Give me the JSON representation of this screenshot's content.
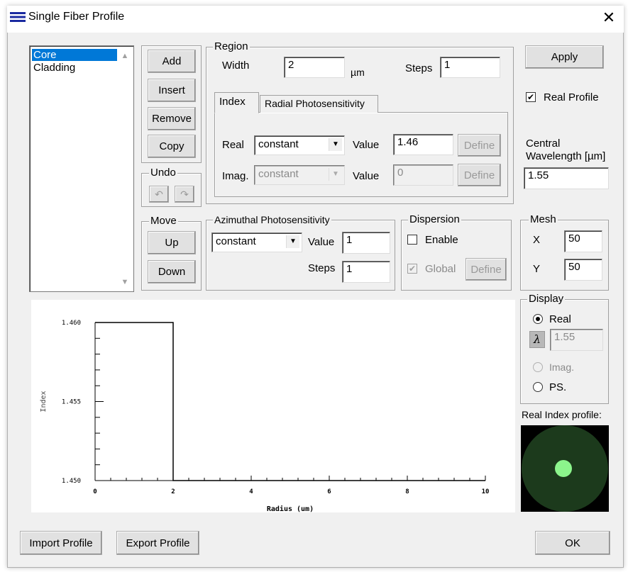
{
  "window": {
    "title": "Single Fiber Profile",
    "close_symbol": "✕"
  },
  "layer_list": {
    "items": [
      "Core",
      "Cladding"
    ],
    "selected_index": 0
  },
  "layer_buttons": {
    "add": "Add",
    "insert": "Insert",
    "remove": "Remove",
    "copy": "Copy"
  },
  "undo": {
    "title": "Undo"
  },
  "move": {
    "title": "Move",
    "up": "Up",
    "down": "Down"
  },
  "region": {
    "title": "Region",
    "width_label": "Width",
    "width_value": "2",
    "width_unit": "µm",
    "steps_label": "Steps",
    "steps_value": "1",
    "tabs": [
      "Index",
      "Radial Photosensitivity"
    ],
    "real_label": "Real",
    "real_select": "constant",
    "real_value_label": "Value",
    "real_value": "1.46",
    "real_define": "Define",
    "imag_label": "Imag.",
    "imag_select": "constant",
    "imag_value_label": "Value",
    "imag_value": "0",
    "imag_define": "Define"
  },
  "right_panel": {
    "apply": "Apply",
    "real_profile_label": "Real Profile",
    "real_profile_checked": true,
    "central_wavelength_label_1": "Central",
    "central_wavelength_label_2": "Wavelength [µm]",
    "central_wavelength_value": "1.55"
  },
  "azimuthal": {
    "title": "Azimuthal Photosensitivity",
    "select": "constant",
    "value_label": "Value",
    "value": "1",
    "steps_label": "Steps",
    "steps_value": "1"
  },
  "dispersion": {
    "title": "Dispersion",
    "enable_label": "Enable",
    "enable_checked": false,
    "global_label": "Global",
    "global_checked": true,
    "define": "Define"
  },
  "mesh": {
    "title": "Mesh",
    "x_label": "X",
    "x_value": "50",
    "y_label": "Y",
    "y_value": "50"
  },
  "display": {
    "title": "Display",
    "real_label": "Real",
    "lambda_symbol": "λ",
    "lambda_value": "1.55",
    "imag_label": "Imag.",
    "ps_label": "PS.",
    "selected": "Real"
  },
  "index_profile": {
    "label": "Real Index profile:",
    "bg_color": "#000000",
    "cladding_color": "#1c3a1c",
    "core_color": "#8cf58c"
  },
  "bottom_buttons": {
    "import": "Import Profile",
    "export": "Export Profile",
    "ok": "OK"
  },
  "chart_data": {
    "type": "line",
    "xlabel": "Radius (um)",
    "ylabel": "Index",
    "xlim": [
      0,
      10
    ],
    "ylim": [
      1.45,
      1.46
    ],
    "x_ticks": [
      "0",
      "2",
      "4",
      "6",
      "8",
      "10"
    ],
    "y_ticks": [
      "1.450",
      "1.455",
      "1.460"
    ],
    "series": [
      {
        "x": [
          0,
          2,
          2,
          10
        ],
        "y": [
          1.46,
          1.46,
          1.45,
          1.45
        ]
      }
    ],
    "grid": false
  }
}
